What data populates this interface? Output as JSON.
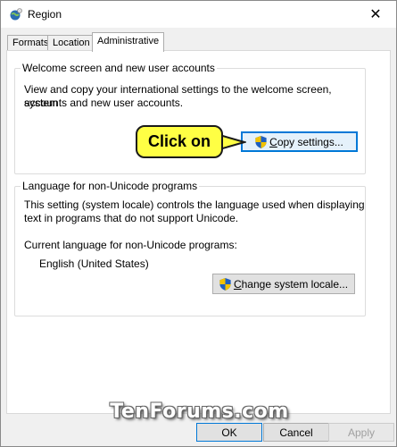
{
  "window": {
    "title": "Region",
    "close_glyph": "✕"
  },
  "tabs": [
    {
      "label": "Formats",
      "active": false
    },
    {
      "label": "Location",
      "active": false
    },
    {
      "label": "Administrative",
      "active": true
    }
  ],
  "welcome_group": {
    "legend": "Welcome screen and new user accounts",
    "description_line1": "View and copy your international settings to the welcome screen, system",
    "description_line2": "accounts and new user accounts.",
    "copy_button": {
      "underlined": "C",
      "rest": "opy settings...",
      "icon": "uac-shield-icon"
    }
  },
  "callout": {
    "text": "Click on",
    "color": "#ffff44"
  },
  "unicode_group": {
    "legend": "Language for non-Unicode programs",
    "description_line1": "This setting (system locale) controls the language used when displaying",
    "description_line2": "text in programs that do not support Unicode.",
    "current_label": "Current language for non-Unicode programs:",
    "current_value": "English (United States)",
    "change_button": {
      "underlined": "C",
      "rest": "hange system locale...",
      "icon": "uac-shield-icon"
    }
  },
  "watermark": "TenForums.com",
  "footer": {
    "ok_label": "OK",
    "cancel_label": "Cancel",
    "apply_label": "Apply"
  },
  "colors": {
    "focus_border": "#0078d7",
    "shield_blue": "#1f5fbf",
    "shield_yellow": "#f2c200"
  }
}
